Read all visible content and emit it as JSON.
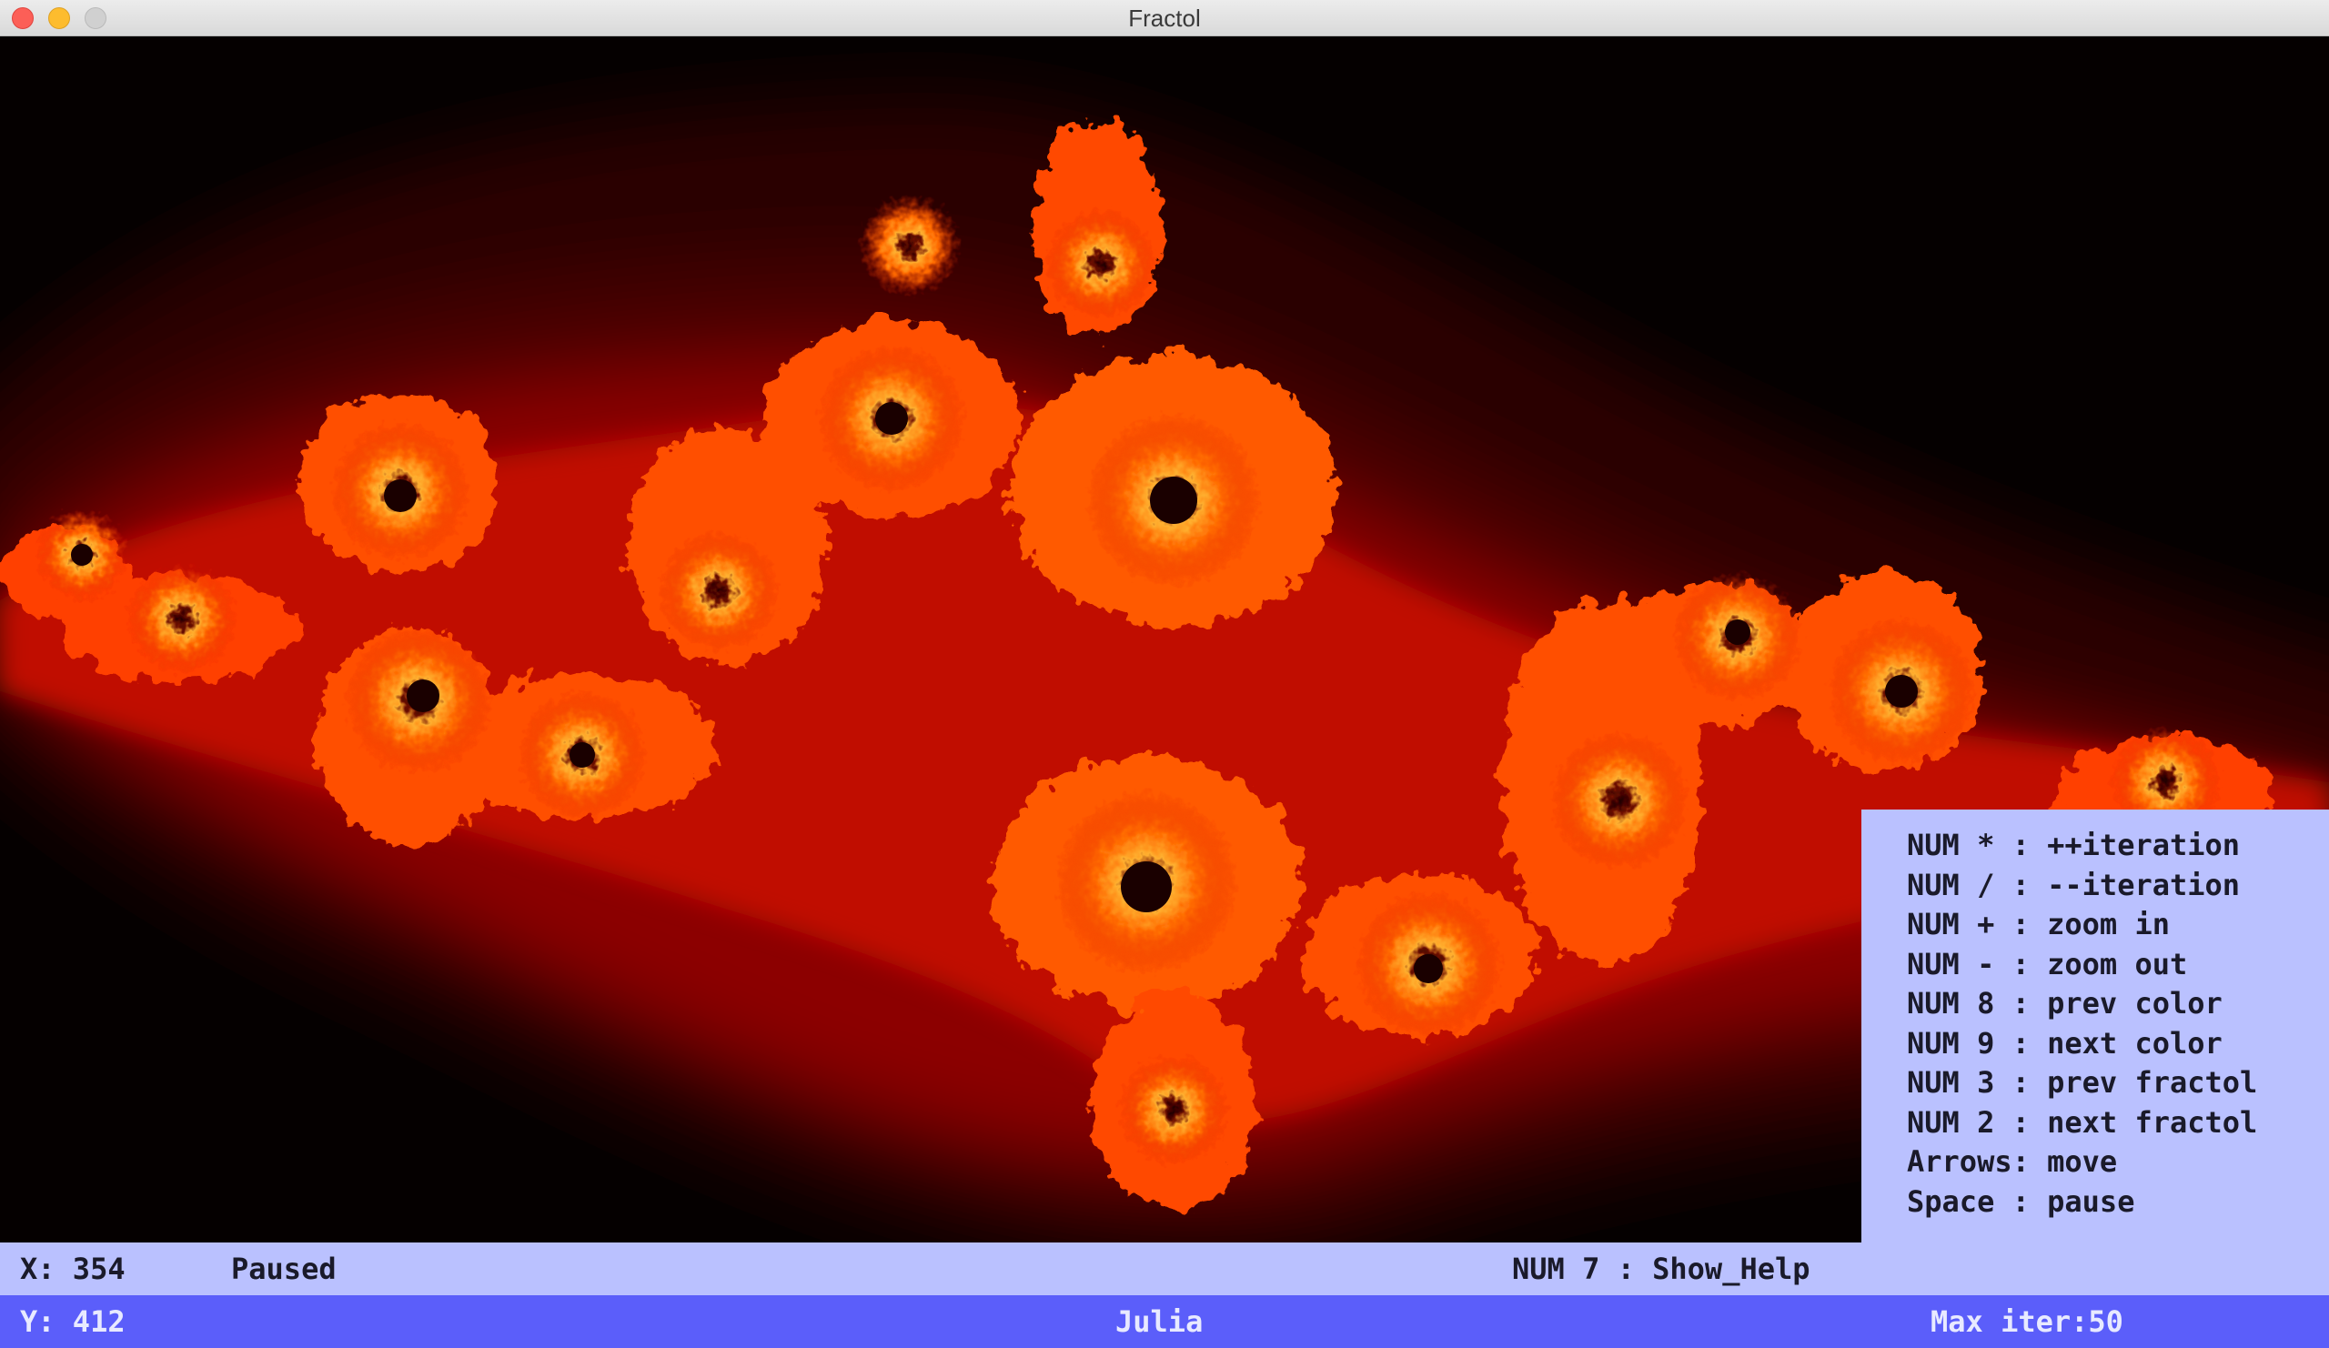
{
  "window": {
    "title": "Fractol"
  },
  "fractal": {
    "name": "Julia",
    "palette": {
      "background": "#050000",
      "outer": "#2a0000",
      "mid": "#8c0000",
      "bright": "#e01a00",
      "glow": "#ff6a00",
      "edge": "#ffb030",
      "core": "#1a0000"
    }
  },
  "help": {
    "lines": [
      "NUM * : ++iteration",
      "NUM / : --iteration",
      "NUM + : zoom in",
      "NUM - : zoom out",
      "NUM 8 : prev color",
      "NUM 9 : next color",
      "NUM 3 : prev fractol",
      "NUM 2 : next fractol",
      "Arrows: move",
      "Space : pause"
    ]
  },
  "status": {
    "x_label": "X: 354",
    "state": "Paused",
    "help_hint": "NUM 7 : Show_Help",
    "y_label": "Y: 412",
    "fractal_name": "Julia",
    "max_iter": "Max iter:50"
  },
  "colors": {
    "panel": "#bac1ff",
    "status_bottom": "#5b5efa"
  }
}
